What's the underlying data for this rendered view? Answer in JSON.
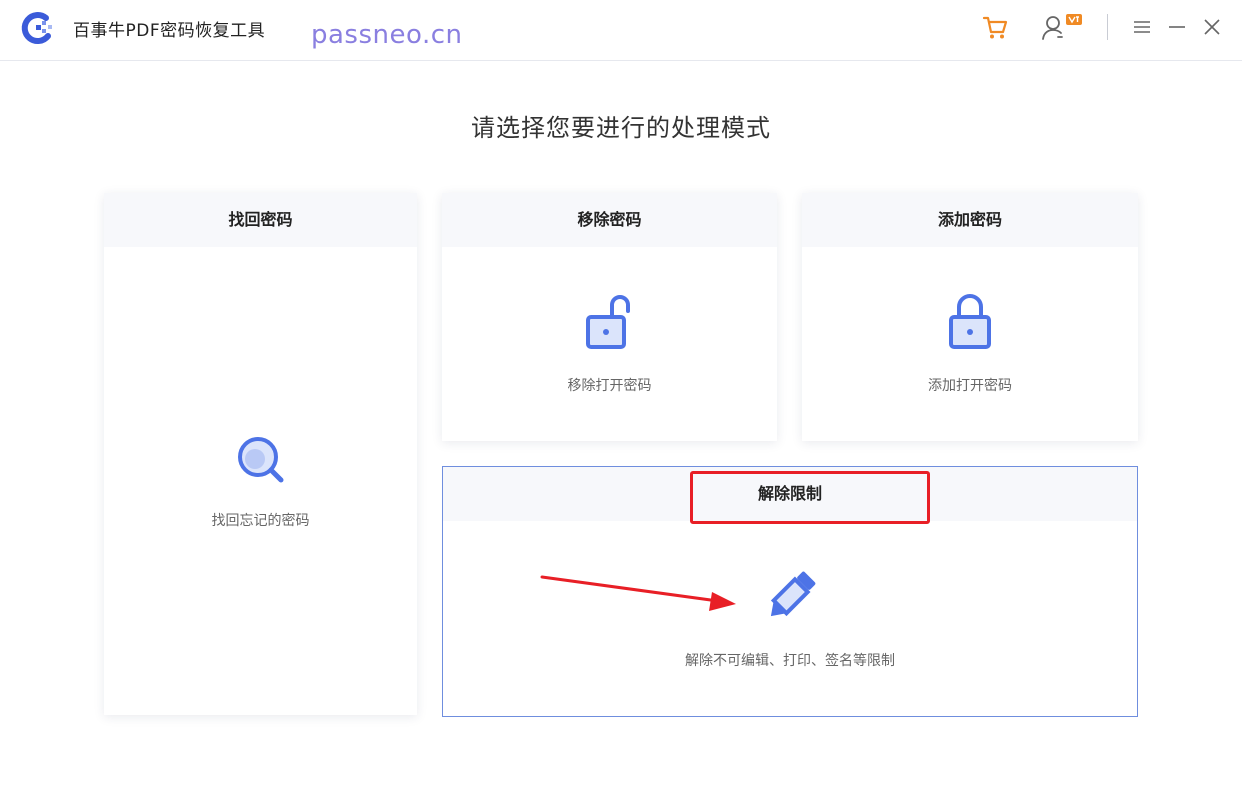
{
  "app": {
    "title": "百事牛PDF密码恢复工具",
    "watermark": "passneo.cn"
  },
  "titlebar": {
    "icons": [
      "cart-icon",
      "user-vip-icon",
      "menu-icon",
      "minimize-icon",
      "close-icon"
    ]
  },
  "heading": "请选择您要进行的处理模式",
  "cards": {
    "recover": {
      "title": "找回密码",
      "desc": "找回忘记的密码",
      "icon": "search-icon"
    },
    "remove": {
      "title": "移除密码",
      "desc": "移除打开密码",
      "icon": "unlock-icon"
    },
    "add": {
      "title": "添加密码",
      "desc": "添加打开密码",
      "icon": "lock-icon"
    },
    "unlock": {
      "title": "解除限制",
      "desc": "解除不可编辑、打印、签名等限制",
      "icon": "pencil-icon"
    }
  },
  "colors": {
    "accent": "#4d73e6",
    "cart": "#f08a24",
    "highlight": "#e81f26"
  }
}
